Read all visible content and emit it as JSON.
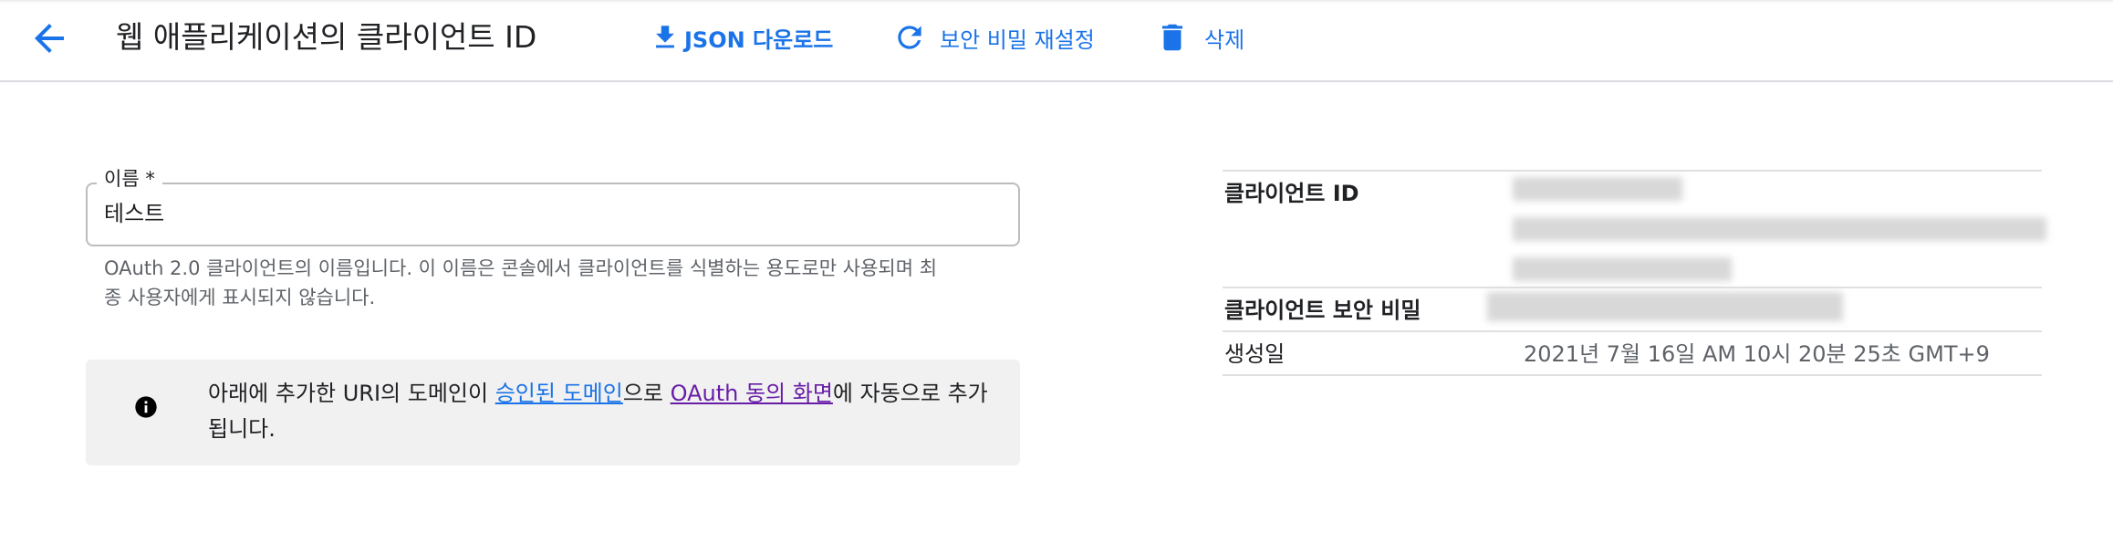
{
  "header": {
    "title": "웹 애플리케이션의 클라이언트 ID",
    "actions": {
      "download": "JSON 다운로드",
      "reset_secret": "보안 비밀 재설정",
      "delete": "삭제"
    }
  },
  "form": {
    "name_label": "이름 *",
    "name_value": "테스트",
    "name_helper_line1": "OAuth 2.0 클라이언트의 이름입니다. 이 이름은 콘솔에서 클라이언트를 식별하는 용도로만 사용되며 최",
    "name_helper_line2": "종 사용자에게 표시되지 않습니다."
  },
  "notice": {
    "text_before": "아래에 추가한 URI의 도메인이 ",
    "link1": "승인된 도메인",
    "text_middle": "으로 ",
    "link2": "OAuth 동의 화면",
    "text_after": "에 자동으로 추가",
    "text_line2": "됩니다."
  },
  "details": {
    "client_id_label": "클라이언트 ID",
    "client_secret_label": "클라이언트 보안 비밀",
    "created_label": "생성일",
    "created_value": "2021년 7월 16일 AM 10시 20분 25초 GMT+9"
  },
  "icons": {
    "back": "arrow-left-icon",
    "download": "download-icon",
    "reset": "refresh-icon",
    "delete": "trash-icon",
    "info": "info-icon"
  },
  "colors": {
    "accent": "#1a73e8",
    "visited_link": "#681da8",
    "notice_bg": "#f1f1f1"
  }
}
